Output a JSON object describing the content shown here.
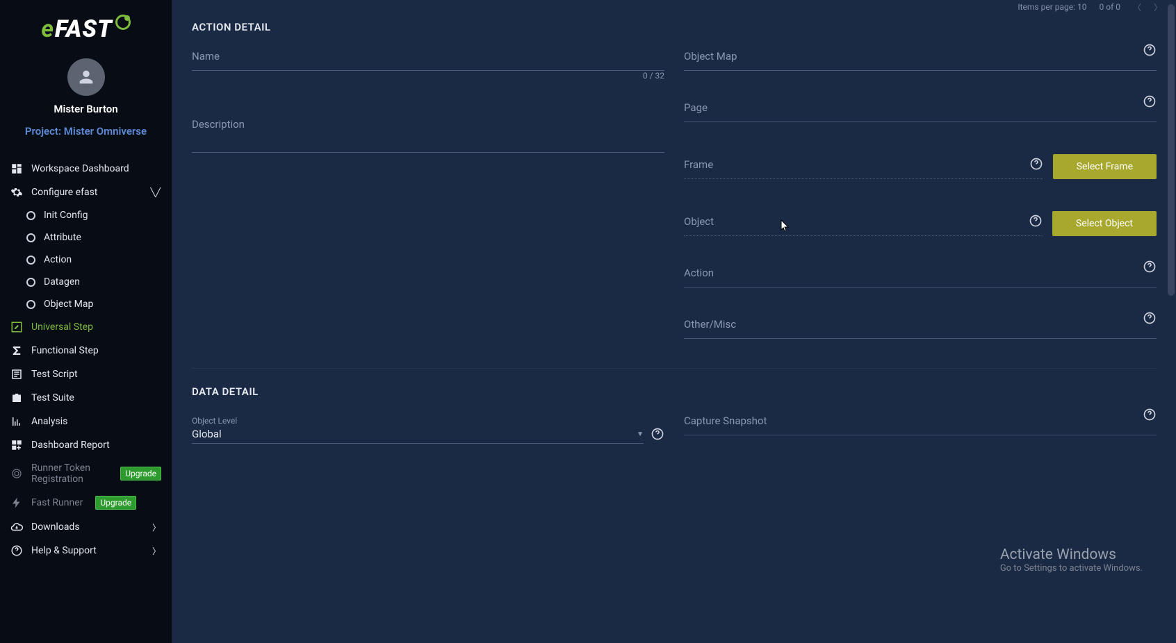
{
  "logo": {
    "e": "e",
    "rest": "FAST"
  },
  "user": {
    "name": "Mister Burton",
    "project_prefix": "Project:",
    "project_name": "Mister Omniverse"
  },
  "nav": {
    "workspace": "Workspace Dashboard",
    "configure": "Configure efast",
    "init_config": "Init Config",
    "attribute": "Attribute",
    "action": "Action",
    "datagen": "Datagen",
    "object_map": "Object Map",
    "universal_step": "Universal Step",
    "functional_step": "Functional Step",
    "test_script": "Test Script",
    "test_suite": "Test Suite",
    "analysis": "Analysis",
    "dashboard_report": "Dashboard Report",
    "runner_token": "Runner Token Registration",
    "fast_runner": "Fast Runner",
    "downloads": "Downloads",
    "help": "Help & Support",
    "upgrade": "Upgrade"
  },
  "topstrip": {
    "items_per_page": "Items per page: 10",
    "range": "0 of 0"
  },
  "section": {
    "action_detail": "ACTION DETAIL",
    "data_detail": "DATA DETAIL"
  },
  "fields": {
    "name": "Name",
    "name_count": "0 / 32",
    "description": "Description",
    "object_map": "Object Map",
    "page": "Page",
    "frame": "Frame",
    "object": "Object",
    "action": "Action",
    "other": "Other/Misc",
    "object_level_label": "Object Level",
    "object_level_value": "Global",
    "capture_snapshot": "Capture Snapshot"
  },
  "buttons": {
    "select_frame": "Select Frame",
    "select_object": "Select Object"
  },
  "watermark": {
    "line1": "Activate Windows",
    "line2": "Go to Settings to activate Windows."
  }
}
